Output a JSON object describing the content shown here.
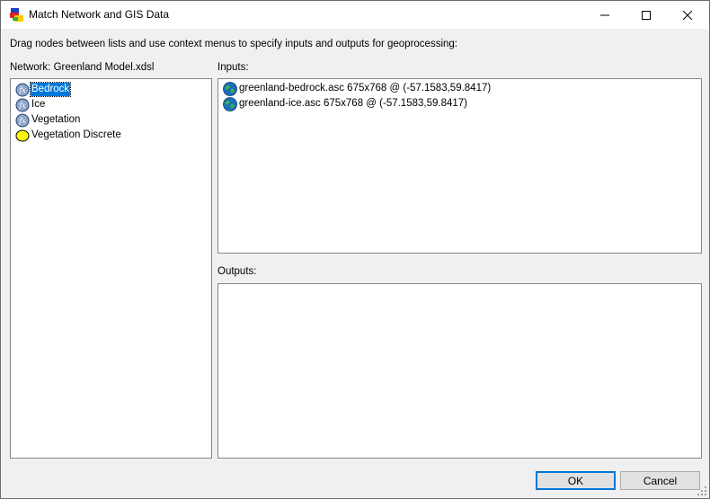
{
  "window": {
    "title": "Match Network and GIS Data",
    "controls": {
      "minimize": "minimize",
      "maximize": "maximize",
      "close": "close"
    }
  },
  "instruction": "Drag nodes between lists and use context menus to specify inputs and outputs for geoprocessing:",
  "network": {
    "label": "Network: Greenland Model.xdsl",
    "nodes": [
      {
        "label": "Bedrock",
        "icon": "function-node-icon",
        "selected": true
      },
      {
        "label": "Ice",
        "icon": "function-node-icon",
        "selected": false
      },
      {
        "label": "Vegetation",
        "icon": "function-node-icon",
        "selected": false
      },
      {
        "label": "Vegetation Discrete",
        "icon": "chance-node-icon",
        "selected": false
      }
    ]
  },
  "inputs": {
    "label": "Inputs:",
    "items": [
      {
        "label": "greenland-bedrock.asc 675x768 @ (-57.1583,59.8417)",
        "icon": "globe-icon"
      },
      {
        "label": "greenland-ice.asc 675x768 @ (-57.1583,59.8417)",
        "icon": "globe-icon"
      }
    ]
  },
  "outputs": {
    "label": "Outputs:",
    "items": []
  },
  "buttons": {
    "ok": "OK",
    "cancel": "Cancel"
  },
  "colors": {
    "selection": "#0078d7",
    "chance_node": "#ffff00",
    "function_node": "#1f5fa8"
  }
}
